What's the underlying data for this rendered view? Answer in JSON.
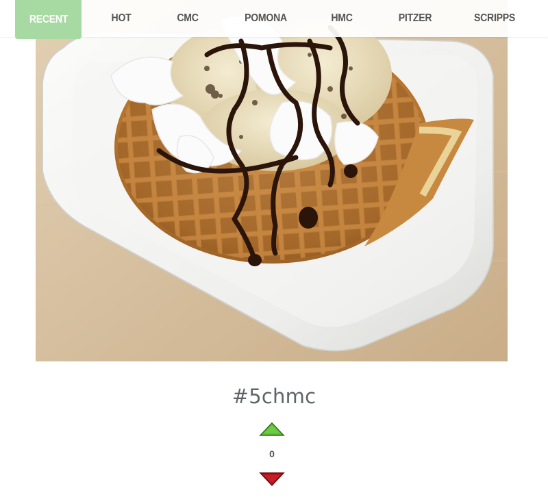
{
  "nav": {
    "items": [
      {
        "label": "RECENT",
        "active": true
      },
      {
        "label": "HOT",
        "active": false
      },
      {
        "label": "CMC",
        "active": false
      },
      {
        "label": "POMONA",
        "active": false
      },
      {
        "label": "HMC",
        "active": false
      },
      {
        "label": "PITZER",
        "active": false
      },
      {
        "label": "SCRIPPS",
        "active": false
      }
    ]
  },
  "post": {
    "image_icon": "waffle-ice-cream-photo",
    "hashtag": "#5chmc",
    "votes": "0",
    "upvote_icon": "upvote-triangle-icon",
    "downvote_icon": "downvote-triangle-icon"
  },
  "colors": {
    "active_tab": "#a7d9a2",
    "nav_text": "#555555",
    "hashtag_text": "#5f6368",
    "upvote": "#5cbf35",
    "downvote": "#b5121b"
  }
}
